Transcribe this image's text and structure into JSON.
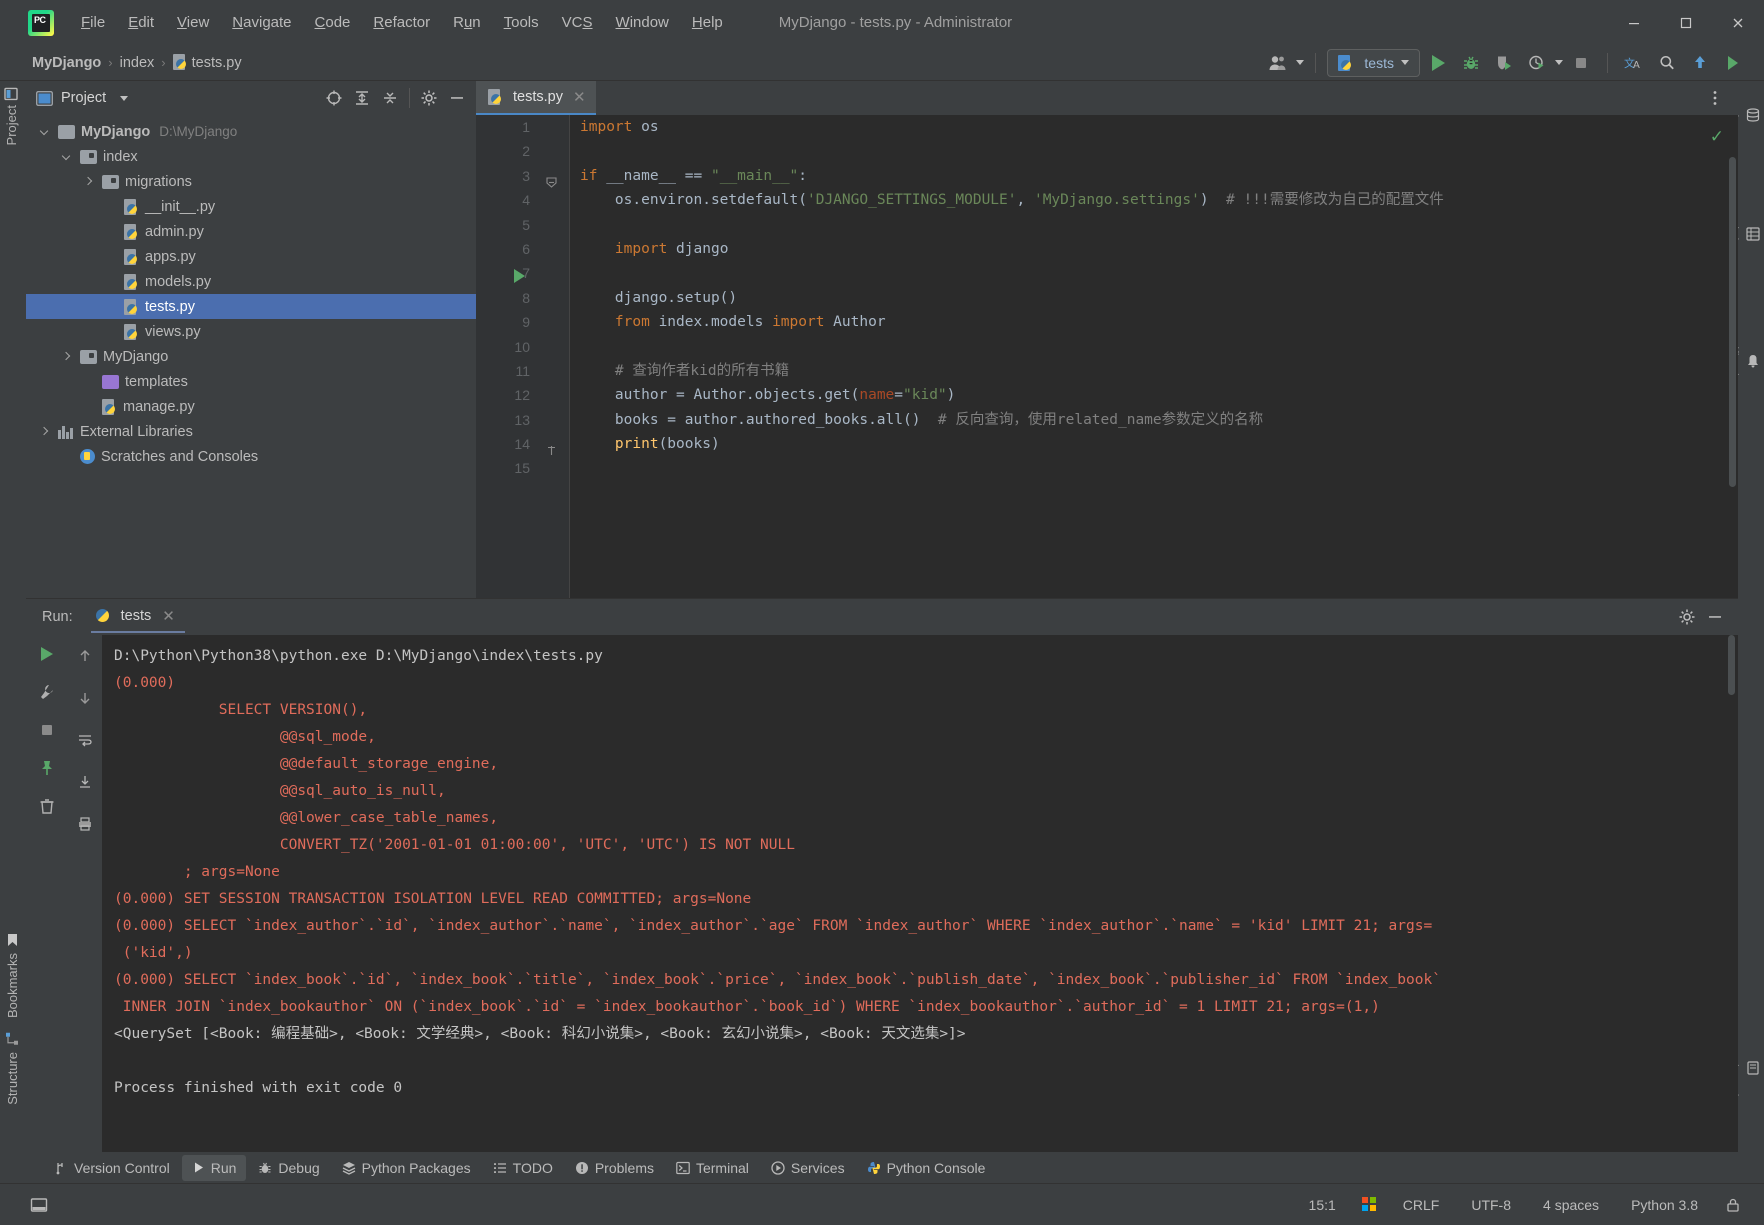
{
  "window": {
    "title": "MyDjango - tests.py - Administrator",
    "minimize": "—",
    "maximize": "☐",
    "close": "✕"
  },
  "menu": [
    {
      "label": "File",
      "accel": "F"
    },
    {
      "label": "Edit",
      "accel": "E"
    },
    {
      "label": "View",
      "accel": "V"
    },
    {
      "label": "Navigate",
      "accel": "N"
    },
    {
      "label": "Code",
      "accel": "C"
    },
    {
      "label": "Refactor",
      "accel": "R"
    },
    {
      "label": "Run",
      "accel": "u"
    },
    {
      "label": "Tools",
      "accel": "T"
    },
    {
      "label": "VCS",
      "accel": "S"
    },
    {
      "label": "Window",
      "accel": "W"
    },
    {
      "label": "Help",
      "accel": "H"
    }
  ],
  "breadcrumb": {
    "sep": "›",
    "items": [
      "MyDjango",
      "index",
      "tests.py"
    ]
  },
  "toolbar": {
    "run_config_label": "tests",
    "buttons": [
      "profile-icon",
      "run-icon",
      "debug-icon",
      "coverage-icon",
      "profiler-icon",
      "stop-icon",
      "translate-icon",
      "search-icon",
      "update-icon",
      "play-store-icon"
    ]
  },
  "left_strip": {
    "project": "Project",
    "bookmarks": "Bookmarks",
    "structure": "Structure"
  },
  "right_strip": {
    "database": "Database",
    "sciview": "SciView",
    "notifications": "Notifications",
    "word_book": "Word Book"
  },
  "project_panel": {
    "title": "Project",
    "tree": [
      {
        "indent": 0,
        "arrow": "down",
        "icon": "folder",
        "label": "MyDjango",
        "bold": true,
        "path": "D:\\MyDjango",
        "selected": false
      },
      {
        "indent": 1,
        "arrow": "down",
        "icon": "folder-module",
        "label": "index",
        "bold": false,
        "path": "",
        "selected": false
      },
      {
        "indent": 2,
        "arrow": "right",
        "icon": "folder-module",
        "label": "migrations",
        "bold": false,
        "path": "",
        "selected": false
      },
      {
        "indent": 3,
        "arrow": "none",
        "icon": "python-file",
        "label": "__init__.py",
        "bold": false,
        "path": "",
        "selected": false
      },
      {
        "indent": 3,
        "arrow": "none",
        "icon": "python-file",
        "label": "admin.py",
        "bold": false,
        "path": "",
        "selected": false
      },
      {
        "indent": 3,
        "arrow": "none",
        "icon": "python-file",
        "label": "apps.py",
        "bold": false,
        "path": "",
        "selected": false
      },
      {
        "indent": 3,
        "arrow": "none",
        "icon": "python-file",
        "label": "models.py",
        "bold": false,
        "path": "",
        "selected": false
      },
      {
        "indent": 3,
        "arrow": "none",
        "icon": "python-file",
        "label": "tests.py",
        "bold": false,
        "path": "",
        "selected": true
      },
      {
        "indent": 3,
        "arrow": "none",
        "icon": "python-file",
        "label": "views.py",
        "bold": false,
        "path": "",
        "selected": false
      },
      {
        "indent": 1,
        "arrow": "right",
        "icon": "folder-module",
        "label": "MyDjango",
        "bold": false,
        "path": "",
        "selected": false
      },
      {
        "indent": 2,
        "arrow": "none",
        "icon": "folder-purple",
        "label": "templates",
        "bold": false,
        "path": "",
        "selected": false
      },
      {
        "indent": 2,
        "arrow": "none",
        "icon": "python-file",
        "label": "manage.py",
        "bold": false,
        "path": "",
        "selected": false
      },
      {
        "indent": 0,
        "arrow": "right",
        "icon": "library",
        "label": "External Libraries",
        "bold": false,
        "path": "",
        "selected": false
      },
      {
        "indent": 1,
        "arrow": "none",
        "icon": "scratches",
        "label": "Scratches and Consoles",
        "bold": false,
        "path": "",
        "selected": false
      }
    ]
  },
  "editor": {
    "tab_label": "tests.py",
    "tab_close": "✕",
    "inspection_status": "✓",
    "line_numbers": [
      "1",
      "2",
      "3",
      "4",
      "5",
      "6",
      "7",
      "8",
      "9",
      "10",
      "11",
      "12",
      "13",
      "14",
      "15"
    ],
    "code_lines": [
      [
        {
          "t": "import",
          "c": "kw"
        },
        {
          "t": " os",
          "c": "plain"
        }
      ],
      [],
      [
        {
          "t": "if",
          "c": "kw"
        },
        {
          "t": " __name__ ",
          "c": "plain"
        },
        {
          "t": "==",
          "c": "plain"
        },
        {
          "t": " ",
          "c": "plain"
        },
        {
          "t": "\"__main__\"",
          "c": "str"
        },
        {
          "t": ":",
          "c": "plain"
        }
      ],
      [
        {
          "t": "    os.environ.setdefault(",
          "c": "plain"
        },
        {
          "t": "'DJANGO_SETTINGS_MODULE'",
          "c": "str"
        },
        {
          "t": ", ",
          "c": "plain"
        },
        {
          "t": "'MyDjango.settings'",
          "c": "str"
        },
        {
          "t": ")  ",
          "c": "plain"
        },
        {
          "t": "# !!!需要修改为自己的配置文件",
          "c": "cmt"
        }
      ],
      [],
      [
        {
          "t": "    ",
          "c": "plain"
        },
        {
          "t": "import",
          "c": "kw"
        },
        {
          "t": " django",
          "c": "plain"
        }
      ],
      [],
      [
        {
          "t": "    django.setup()",
          "c": "plain"
        }
      ],
      [
        {
          "t": "    ",
          "c": "plain"
        },
        {
          "t": "from",
          "c": "kw"
        },
        {
          "t": " index.models ",
          "c": "plain"
        },
        {
          "t": "import",
          "c": "kw"
        },
        {
          "t": " Author",
          "c": "plain"
        }
      ],
      [],
      [
        {
          "t": "    ",
          "c": "plain"
        },
        {
          "t": "# 查询作者kid的所有书籍",
          "c": "cmt"
        }
      ],
      [
        {
          "t": "    author = Author.objects.get(",
          "c": "plain"
        },
        {
          "t": "name",
          "c": "param"
        },
        {
          "t": "=",
          "c": "plain"
        },
        {
          "t": "\"kid\"",
          "c": "str"
        },
        {
          "t": ")",
          "c": "plain"
        }
      ],
      [
        {
          "t": "    books = author.authored_books.all()  ",
          "c": "plain"
        },
        {
          "t": "# 反向查询，使用related_name参数定义的名称",
          "c": "cmt"
        }
      ],
      [
        {
          "t": "    ",
          "c": "plain"
        },
        {
          "t": "print",
          "c": "fn"
        },
        {
          "t": "(books)",
          "c": "plain"
        }
      ],
      []
    ]
  },
  "run_panel": {
    "label": "Run:",
    "tab_label": "tests",
    "tab_close": "✕",
    "output": [
      {
        "text": "D:\\Python\\Python38\\python.exe D:\\MyDjango\\index\\tests.py",
        "color": "white"
      },
      {
        "text": "(0.000)",
        "color": "red"
      },
      {
        "text": "            SELECT VERSION(),",
        "color": "red"
      },
      {
        "text": "                   @@sql_mode,",
        "color": "red"
      },
      {
        "text": "                   @@default_storage_engine,",
        "color": "red"
      },
      {
        "text": "                   @@sql_auto_is_null,",
        "color": "red"
      },
      {
        "text": "                   @@lower_case_table_names,",
        "color": "red"
      },
      {
        "text": "                   CONVERT_TZ('2001-01-01 01:00:00', 'UTC', 'UTC') IS NOT NULL",
        "color": "red"
      },
      {
        "text": "        ; args=None",
        "color": "red"
      },
      {
        "text": "(0.000) SET SESSION TRANSACTION ISOLATION LEVEL READ COMMITTED; args=None",
        "color": "red"
      },
      {
        "text": "(0.000) SELECT `index_author`.`id`, `index_author`.`name`, `index_author`.`age` FROM `index_author` WHERE `index_author`.`name` = 'kid' LIMIT 21; args=",
        "color": "red"
      },
      {
        "text": " ('kid',)",
        "color": "red"
      },
      {
        "text": "(0.000) SELECT `index_book`.`id`, `index_book`.`title`, `index_book`.`price`, `index_book`.`publish_date`, `index_book`.`publisher_id` FROM `index_book`",
        "color": "red"
      },
      {
        "text": " INNER JOIN `index_bookauthor` ON (`index_book`.`id` = `index_bookauthor`.`book_id`) WHERE `index_bookauthor`.`author_id` = 1 LIMIT 21; args=(1,)",
        "color": "red"
      },
      {
        "text": "<QuerySet [<Book: 编程基础>, <Book: 文学经典>, <Book: 科幻小说集>, <Book: 玄幻小说集>, <Book: 天文选集>]>",
        "color": "white"
      },
      {
        "text": "",
        "color": "white"
      },
      {
        "text": "Process finished with exit code 0",
        "color": "white"
      }
    ]
  },
  "bottom_bar": [
    {
      "label": "Version Control",
      "icon": "branch-icon",
      "active": false
    },
    {
      "label": "Run",
      "icon": "play-icon",
      "active": true
    },
    {
      "label": "Debug",
      "icon": "bug-icon",
      "active": false
    },
    {
      "label": "Python Packages",
      "icon": "packages-icon",
      "active": false
    },
    {
      "label": "TODO",
      "icon": "list-icon",
      "active": false
    },
    {
      "label": "Problems",
      "icon": "warning-icon",
      "active": false
    },
    {
      "label": "Terminal",
      "icon": "terminal-icon",
      "active": false
    },
    {
      "label": "Services",
      "icon": "services-icon",
      "active": false
    },
    {
      "label": "Python Console",
      "icon": "python-icon",
      "active": false
    }
  ],
  "status_bar": {
    "caret_position": "15:1",
    "line_separator": "CRLF",
    "encoding": "UTF-8",
    "indent": "4 spaces",
    "interpreter": "Python 3.8"
  }
}
